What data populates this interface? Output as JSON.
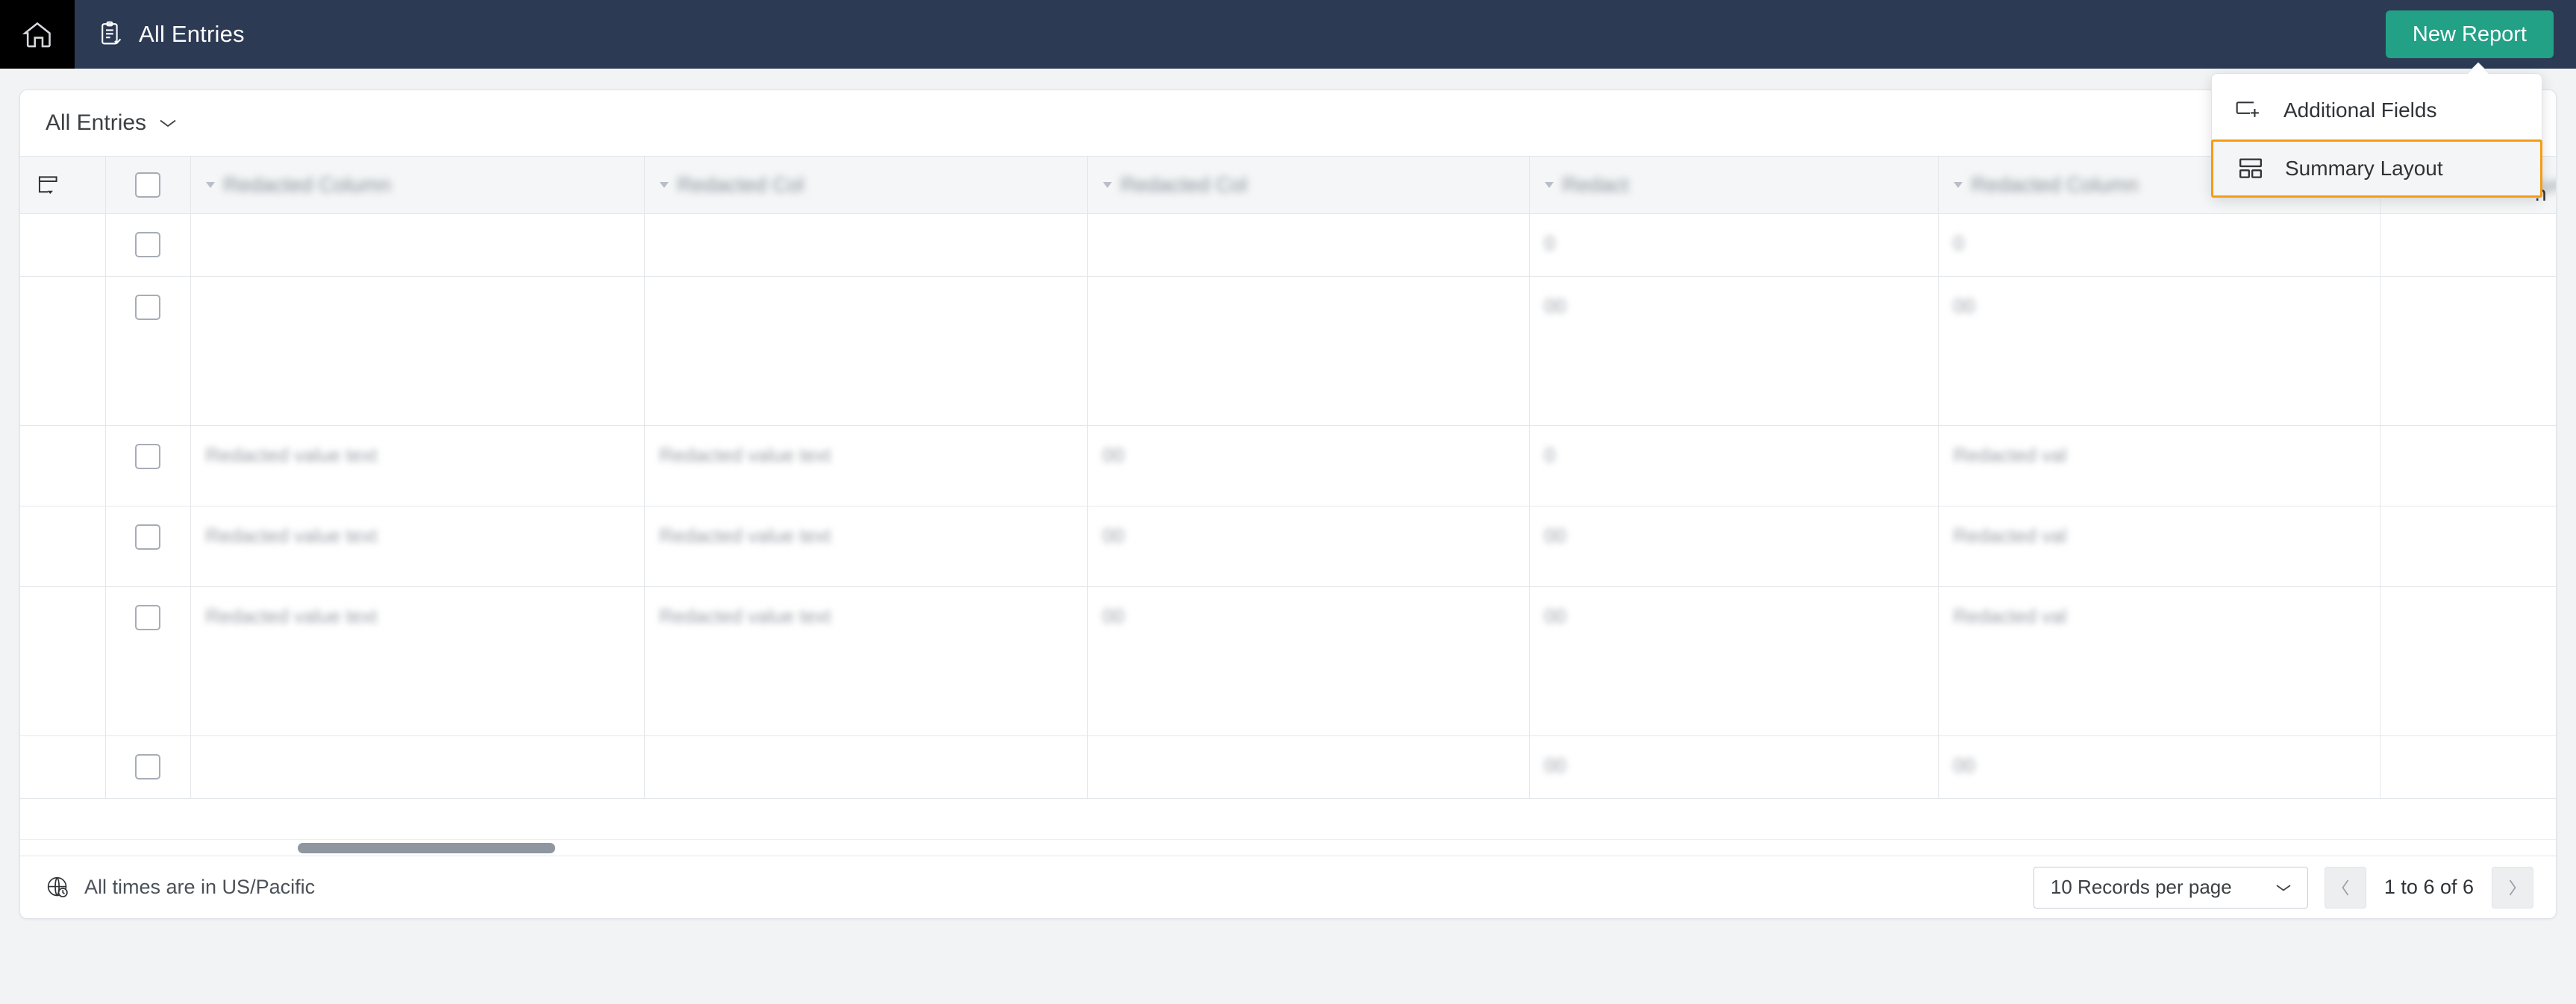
{
  "topnav": {
    "home_icon": "home-icon",
    "app_icon": "clipboard-check-icon",
    "title": "All Entries",
    "new_report_label": "New Report",
    "accent_green": "#22a186",
    "bar_color": "#2c3a54"
  },
  "card_header": {
    "view_label": "All Entries",
    "chevron_icon": "chevron-down-icon",
    "tools": [
      {
        "name": "history-clock-icon"
      },
      {
        "name": "share-export-icon"
      },
      {
        "name": "filter-icon"
      },
      {
        "name": "more-ellipsis-icon"
      }
    ]
  },
  "menu": {
    "highlight_color": "#f59b14",
    "items": [
      {
        "label": "Additional Fields",
        "icon": "add-field-icon",
        "highlighted": false
      },
      {
        "label": "Summary Layout",
        "icon": "summary-layout-icon",
        "highlighted": true
      }
    ]
  },
  "table": {
    "grip_icon": "column-settings-icon",
    "select_all_checkbox": "select-all-checkbox",
    "headers": [
      {
        "label": "",
        "redacted": true,
        "sortable": true
      },
      {
        "label": "",
        "redacted": true,
        "sortable": true
      },
      {
        "label": "",
        "redacted": true,
        "sortable": true
      },
      {
        "label": "",
        "redacted": true,
        "sortable": true
      },
      {
        "label": "",
        "redacted": true,
        "sortable": true
      },
      {
        "label": "",
        "redacted": true,
        "sortable": true
      }
    ],
    "header_redacted_text": [
      "Redacted Column",
      "Redacted Col",
      "Redacted Col",
      "Redact",
      "Redacted Column",
      "Redacted Colum"
    ],
    "rows": [
      {
        "size": "r1",
        "cells": [
          "",
          "",
          "",
          "",
          "",
          ""
        ],
        "redacted": [
          "",
          "",
          "",
          "0",
          "0",
          ""
        ]
      },
      {
        "size": "r2",
        "cells": [
          "",
          "",
          "",
          "",
          "",
          ""
        ],
        "redacted": [
          "",
          "",
          "",
          "00",
          "00",
          ""
        ]
      },
      {
        "size": "r3",
        "cells": [
          "",
          "",
          "",
          "",
          "",
          ""
        ],
        "redacted": [
          "Redacted value text",
          "Redacted value text",
          "00",
          "0",
          "Redacted val",
          ""
        ]
      },
      {
        "size": "r4",
        "cells": [
          "",
          "",
          "",
          "",
          "",
          ""
        ],
        "redacted": [
          "Redacted value text",
          "Redacted value text",
          "00",
          "00",
          "Redacted val",
          ""
        ]
      },
      {
        "size": "r5",
        "cells": [
          "",
          "",
          "",
          "",
          "",
          ""
        ],
        "redacted": [
          "Redacted value text",
          "Redacted value text",
          "00",
          "00",
          "Redacted val",
          ""
        ]
      },
      {
        "size": "r6",
        "cells": [
          "",
          "",
          "",
          "",
          "",
          ""
        ],
        "redacted": [
          "",
          "",
          "",
          "00",
          "00",
          ""
        ]
      }
    ],
    "cut_off_header_text": "n"
  },
  "scrollbar": {
    "horizontal_thumb": "horizontal-scrollbar-thumb"
  },
  "footer": {
    "globe_icon": "globe-clock-icon",
    "timezone_note": "All times are in US/Pacific",
    "records_per_page": "10 Records per page",
    "records_chevron": "chevron-down-icon",
    "prev_icon": "chevron-left-icon",
    "next_icon": "chevron-right-icon",
    "range_label": "1 to 6 of 6"
  }
}
